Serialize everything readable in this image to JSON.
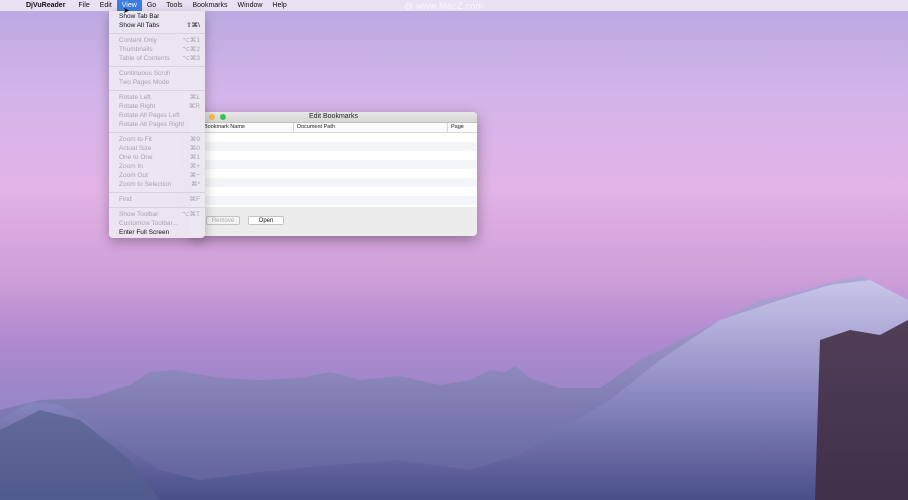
{
  "menubar": {
    "apple": "",
    "app_name": "DjVuReader",
    "items": [
      "File",
      "Edit",
      "View",
      "Go",
      "Tools",
      "Bookmarks",
      "Window",
      "Help"
    ],
    "watermark": "@ www.MacZ.com"
  },
  "view_menu": {
    "show_tab_bar": {
      "label": "Show Tab Bar",
      "shortcut": ""
    },
    "show_all_tabs": {
      "label": "Show All Tabs",
      "shortcut": "⇧⌘\\"
    },
    "content_only": {
      "label": "Content Only",
      "shortcut": "⌥⌘1"
    },
    "thumbnails": {
      "label": "Thumbnails",
      "shortcut": "⌥⌘2"
    },
    "table_of_contents": {
      "label": "Table of Contents",
      "shortcut": "⌥⌘3"
    },
    "continuous_scroll": {
      "label": "Continuous Scroll",
      "shortcut": ""
    },
    "two_pages_mode": {
      "label": "Two Pages Mode",
      "shortcut": ""
    },
    "rotate_left": {
      "label": "Rotate Left",
      "shortcut": "⌘L"
    },
    "rotate_right": {
      "label": "Rotate Right",
      "shortcut": "⌘R"
    },
    "rotate_all_left": {
      "label": "Rotate All Pages Left",
      "shortcut": ""
    },
    "rotate_all_right": {
      "label": "Rotate All Pages Right",
      "shortcut": ""
    },
    "zoom_to_fit": {
      "label": "Zoom to Fit",
      "shortcut": "⌘9"
    },
    "actual_size": {
      "label": "Actual Size",
      "shortcut": "⌘0"
    },
    "one_to_one": {
      "label": "One to One",
      "shortcut": "⌘1"
    },
    "zoom_in": {
      "label": "Zoom In",
      "shortcut": "⌘+"
    },
    "zoom_out": {
      "label": "Zoom Out",
      "shortcut": "⌘−"
    },
    "zoom_to_selection": {
      "label": "Zoom to Selection",
      "shortcut": "⌘*"
    },
    "find": {
      "label": "Find",
      "shortcut": "⌘F"
    },
    "show_toolbar": {
      "label": "Show Toolbar",
      "shortcut": "⌥⌘T"
    },
    "customize_toolbar": {
      "label": "Customize Toolbar...",
      "shortcut": ""
    },
    "enter_full_screen": {
      "label": "Enter Full Screen",
      "shortcut": ""
    }
  },
  "window": {
    "title": "Edit Bookmarks",
    "columns": [
      "Bookmark Name",
      "Document Path",
      "Page"
    ],
    "remove_label": "Remove",
    "open_label": "Open"
  },
  "colors": {
    "menu_highlight": "#3d7ee0",
    "close": "#fc605b",
    "minimize": "#fdbc40",
    "zoom": "#34c84a"
  }
}
